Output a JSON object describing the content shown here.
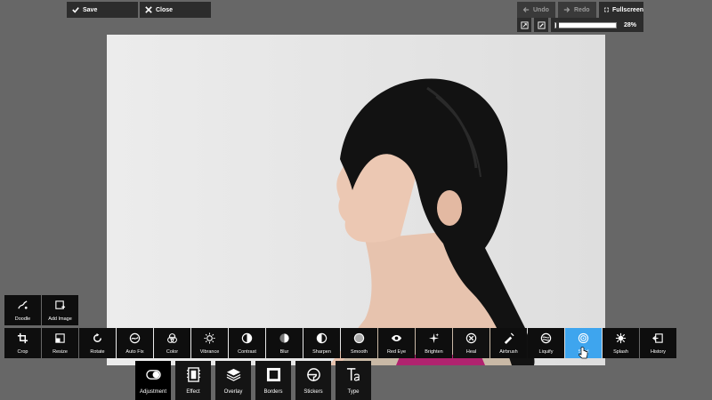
{
  "top": {
    "save": "Save",
    "close": "Close",
    "undo": "Undo",
    "redo": "Redo",
    "fullscreen": "Fullscreen"
  },
  "zoom": {
    "percent_label": "28%",
    "value": 0.28
  },
  "tools_row1": [
    {
      "label": "Doodle",
      "icon": "doodle-icon"
    },
    {
      "label": "Add Image",
      "icon": "add-image-icon"
    }
  ],
  "tools_row2": [
    {
      "label": "Crop",
      "icon": "crop-icon"
    },
    {
      "label": "Resize",
      "icon": "resize-icon"
    },
    {
      "label": "Rotate",
      "icon": "rotate-icon"
    },
    {
      "label": "Auto Fix",
      "icon": "auto-fix-icon"
    },
    {
      "label": "Color",
      "icon": "color-icon"
    },
    {
      "label": "Vibrance",
      "icon": "vibrance-icon"
    },
    {
      "label": "Contrast",
      "icon": "contrast-icon"
    },
    {
      "label": "Blur",
      "icon": "blur-icon"
    },
    {
      "label": "Sharpen",
      "icon": "sharpen-icon"
    },
    {
      "label": "Smooth",
      "icon": "smooth-icon"
    },
    {
      "label": "Red Eye",
      "icon": "red-eye-icon"
    },
    {
      "label": "Brighten",
      "icon": "brighten-icon"
    },
    {
      "label": "Heal",
      "icon": "heal-icon"
    },
    {
      "label": "Airbrush",
      "icon": "airbrush-icon"
    },
    {
      "label": "Liquify",
      "icon": "liquify-icon"
    },
    {
      "label": "Swirl",
      "icon": "swirl-icon"
    },
    {
      "label": "Splash",
      "icon": "splash-icon"
    },
    {
      "label": "History",
      "icon": "history-icon"
    }
  ],
  "categories": [
    {
      "label": "Adjustment",
      "icon": "adjustment-icon"
    },
    {
      "label": "Effect",
      "icon": "effect-icon"
    },
    {
      "label": "Overlay",
      "icon": "overlay-icon"
    },
    {
      "label": "Borders",
      "icon": "borders-icon"
    },
    {
      "label": "Stickers",
      "icon": "stickers-icon"
    },
    {
      "label": "Type",
      "icon": "type-icon"
    }
  ],
  "colors": {
    "background": "#676767",
    "toolbar": "#0e0e0e",
    "active_tool": "#3ea5ee"
  }
}
